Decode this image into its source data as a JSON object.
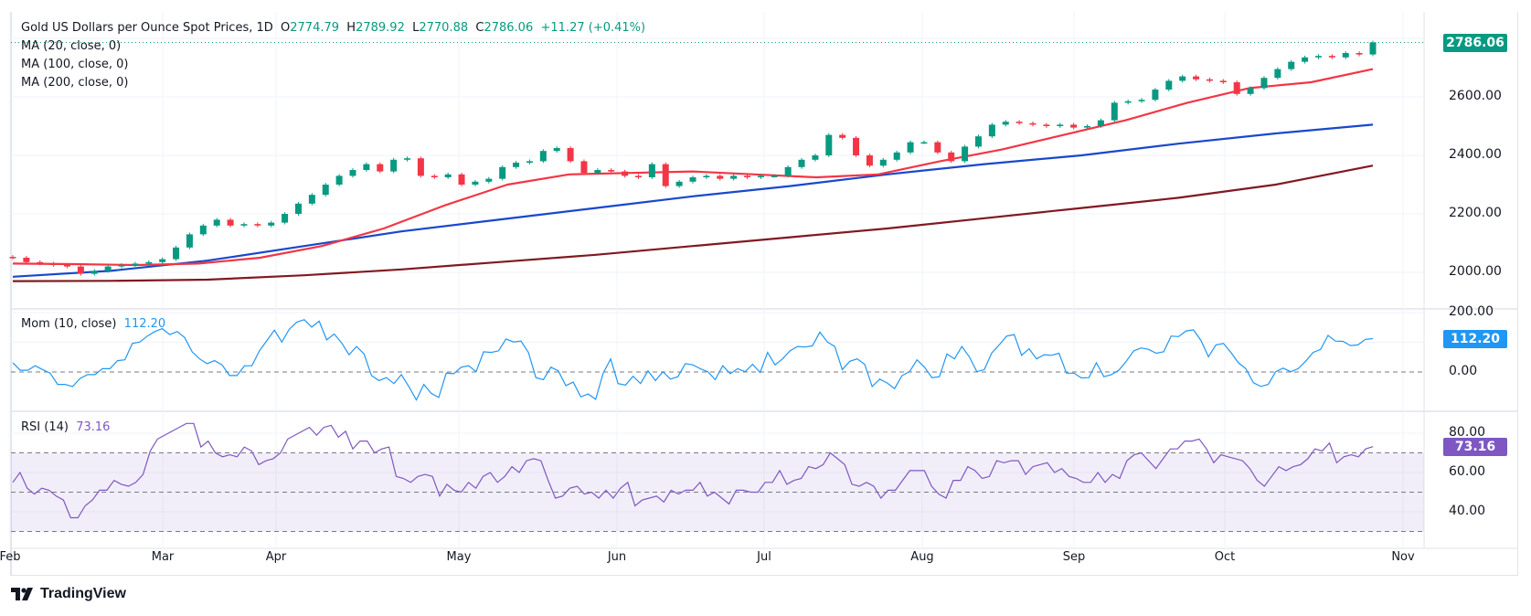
{
  "header": {
    "symbol": "Gold US Dollars per Ounce Spot Prices, 1D",
    "open_label": "O",
    "open": "2774.79",
    "high_label": "H",
    "high": "2789.92",
    "low_label": "L",
    "low": "2770.88",
    "close_label": "C",
    "close": "2786.06",
    "change": "+11.27 (+0.41%)"
  },
  "indicators": {
    "ma20": "MA (20, close, 0)",
    "ma100": "MA (100, close, 0)",
    "ma200": "MA (200, close, 0)",
    "mom_label": "Mom (10, close)",
    "mom_value": "112.20",
    "rsi_label": "RSI (14)",
    "rsi_value": "73.16"
  },
  "price_badge": "2786.06",
  "mom_badge": "112.20",
  "rsi_badge": "73.16",
  "price_ticks": [
    "2600.00",
    "2400.00",
    "2200.00",
    "2000.00"
  ],
  "mom_ticks": [
    "200.00",
    "0.00"
  ],
  "rsi_ticks": [
    "80.00",
    "60.00",
    "40.00"
  ],
  "months": [
    "Feb",
    "Mar",
    "Apr",
    "May",
    "Jun",
    "Jul",
    "Aug",
    "Sep",
    "Oct",
    "Nov"
  ],
  "logo_text": "TradingView",
  "colors": {
    "up": "#089981",
    "down": "#f23645",
    "ma20": "#f23645",
    "ma100": "#1848cc",
    "ma200": "#801922",
    "mom": "#2196f3",
    "rsi": "#7e57c2"
  },
  "chart_data": [
    {
      "type": "candlestick",
      "title": "Gold US Dollars per Ounce Spot Prices, 1D",
      "ylim": [
        1940,
        2800
      ],
      "y_ticks": [
        2000,
        2200,
        2400,
        2600
      ],
      "x_ticks": [
        "Feb",
        "Mar",
        "Apr",
        "May",
        "Jun",
        "Jul",
        "Aug",
        "Sep",
        "Oct",
        "Nov"
      ],
      "last_price": 2786.06,
      "close": [
        2050,
        2035,
        2030,
        2025,
        2020,
        1995,
        2005,
        2020,
        2025,
        2030,
        2035,
        2045,
        2085,
        2130,
        2160,
        2180,
        2160,
        2165,
        2160,
        2170,
        2200,
        2235,
        2265,
        2300,
        2330,
        2350,
        2370,
        2345,
        2385,
        2390,
        2330,
        2325,
        2335,
        2300,
        2310,
        2320,
        2360,
        2375,
        2380,
        2415,
        2425,
        2380,
        2340,
        2350,
        2345,
        2330,
        2325,
        2370,
        2295,
        2310,
        2325,
        2330,
        2320,
        2330,
        2325,
        2330,
        2330,
        2360,
        2385,
        2400,
        2470,
        2460,
        2400,
        2365,
        2385,
        2410,
        2445,
        2445,
        2410,
        2380,
        2430,
        2465,
        2505,
        2515,
        2510,
        2505,
        2500,
        2505,
        2495,
        2500,
        2520,
        2580,
        2585,
        2590,
        2625,
        2655,
        2670,
        2660,
        2655,
        2650,
        2610,
        2630,
        2665,
        2695,
        2720,
        2735,
        2740,
        2735,
        2750,
        2745,
        2786.06
      ],
      "series": [
        {
          "name": "MA (20, close, 0)",
          "values": [
            2030,
            2028,
            2025,
            2030,
            2050,
            2090,
            2150,
            2230,
            2300,
            2335,
            2340,
            2345,
            2335,
            2325,
            2335,
            2380,
            2420,
            2470,
            2520,
            2580,
            2630,
            2650,
            2695
          ]
        },
        {
          "name": "MA (100, close, 0)",
          "values": [
            1985,
            2005,
            2040,
            2090,
            2140,
            2180,
            2220,
            2260,
            2295,
            2335,
            2370,
            2400,
            2440,
            2475,
            2505
          ]
        },
        {
          "name": "MA (200, close, 0)",
          "values": [
            1970,
            1971,
            1975,
            1990,
            2010,
            2035,
            2060,
            2090,
            2120,
            2150,
            2185,
            2220,
            2255,
            2300,
            2365
          ]
        }
      ]
    },
    {
      "type": "line",
      "title": "Mom (10, close)",
      "ylim": [
        -100,
        200
      ],
      "y_ticks": [
        200,
        0
      ],
      "series": [
        {
          "name": "Mom (10, close)",
          "values": [
            31,
            6,
            6,
            21,
            8,
            -4,
            -42,
            -42,
            -49,
            -22,
            -9,
            -9,
            11,
            11,
            38,
            41,
            96,
            101,
            121,
            136,
            146,
            126,
            136,
            116,
            68,
            44,
            28,
            38,
            24,
            -12,
            -12,
            21,
            21,
            71,
            106,
            141,
            101,
            144,
            168,
            176,
            151,
            171,
            108,
            128,
            98,
            58,
            86,
            61,
            -12,
            -29,
            -19,
            -39,
            -9,
            -49,
            -94,
            -42,
            -72,
            -86,
            -4,
            -6,
            16,
            21,
            1,
            68,
            66,
            71,
            111,
            101,
            104,
            66,
            -19,
            -26,
            16,
            4,
            -46,
            -34,
            -84,
            -74,
            -92,
            -4,
            44,
            -39,
            -44,
            -14,
            -39,
            4,
            -29,
            1,
            -24,
            -16,
            28,
            24,
            11,
            1,
            -26,
            21,
            -6,
            11,
            1,
            26,
            -2,
            66,
            24,
            44,
            71,
            86,
            84,
            88,
            134,
            101,
            86,
            8,
            36,
            44,
            26,
            -49,
            -24,
            -37,
            -56,
            -12,
            1,
            41,
            16,
            -19,
            -16,
            61,
            44,
            86,
            51,
            1,
            8,
            64,
            91,
            121,
            126,
            56,
            78,
            44,
            58,
            56,
            63,
            -4,
            -4,
            -20,
            -19,
            31,
            -16,
            -9,
            6,
            36,
            71,
            81,
            76,
            63,
            68,
            121,
            119,
            138,
            142,
            106,
            51,
            91,
            96,
            66,
            31,
            11,
            -36,
            -49,
            -42,
            1,
            13,
            1,
            11,
            36,
            66,
            76,
            123,
            104,
            103,
            89,
            91,
            110,
            112.2
          ]
        }
      ]
    },
    {
      "type": "line",
      "title": "RSI (14)",
      "ylim": [
        25,
        90
      ],
      "y_ticks": [
        80,
        60,
        40
      ],
      "bands": [
        70,
        50,
        30
      ],
      "series": [
        {
          "name": "RSI (14)",
          "values": [
            55,
            60,
            52,
            49,
            52,
            51,
            48,
            46,
            37,
            37,
            43,
            46,
            51,
            51,
            56,
            54,
            53,
            55,
            59,
            71,
            77,
            79,
            81,
            83,
            85,
            85,
            73,
            76,
            70,
            68,
            69,
            68,
            73,
            71,
            64,
            66,
            67,
            70,
            77,
            79,
            81,
            83,
            79,
            83,
            84,
            78,
            81,
            72,
            76,
            76,
            70,
            72,
            73,
            58,
            57,
            55,
            58,
            59,
            58,
            48,
            54,
            51,
            50,
            55,
            52,
            58,
            60,
            55,
            58,
            63,
            60,
            66,
            67,
            66,
            56,
            47,
            48,
            52,
            53,
            49,
            50,
            47,
            51,
            47,
            52,
            55,
            43,
            46,
            47,
            48,
            45,
            51,
            49,
            51,
            51,
            55,
            48,
            50,
            47,
            44,
            51,
            51,
            50,
            50,
            55,
            55,
            61,
            54,
            56,
            57,
            63,
            62,
            64,
            70,
            67,
            64,
            54,
            53,
            55,
            53,
            47,
            51,
            51,
            56,
            61,
            61,
            61,
            53,
            49,
            47,
            56,
            56,
            63,
            61,
            57,
            58,
            66,
            65,
            66,
            66,
            59,
            63,
            64,
            65,
            60,
            62,
            58,
            57,
            55,
            55,
            60,
            55,
            59,
            57,
            66,
            69,
            70,
            66,
            62,
            67,
            72,
            72,
            76,
            76,
            77,
            72,
            65,
            69,
            68,
            67,
            66,
            62,
            56,
            53,
            58,
            63,
            61,
            63,
            64,
            67,
            72,
            71,
            75,
            65,
            68,
            69,
            68,
            72,
            73.16
          ]
        }
      ]
    }
  ]
}
